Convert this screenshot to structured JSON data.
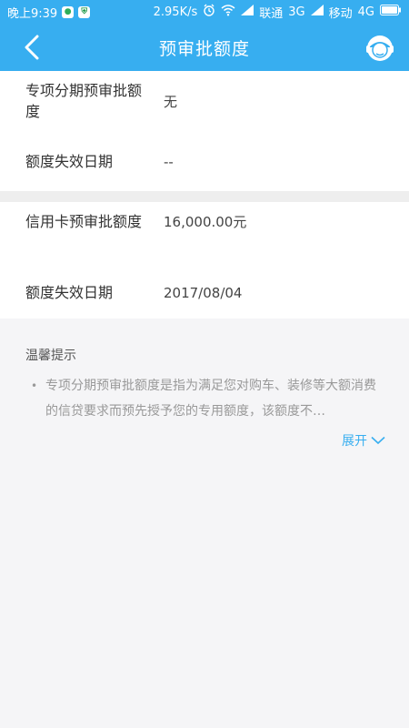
{
  "status_bar": {
    "time": "晚上9:39",
    "speed": "2.95K/s",
    "carrier1": "联通",
    "net1": "3G",
    "carrier2": "移动",
    "net2": "4G"
  },
  "nav": {
    "title": "预审批额度",
    "back_icon": "chevron-left-icon",
    "service_icon": "customer-service-icon"
  },
  "section1": {
    "rows": [
      {
        "label": "专项分期预审批额度",
        "value": "无"
      },
      {
        "label": "额度失效日期",
        "value": "--"
      }
    ]
  },
  "section2": {
    "rows": [
      {
        "label": "信用卡预审批额度",
        "value": "16,000.00元"
      },
      {
        "label": "额度失效日期",
        "value": "2017/08/04"
      }
    ]
  },
  "tips": {
    "title": "温馨提示",
    "items": [
      {
        "text": "专项分期预审批额度是指为满足您对购车、装修等大额消费的信贷要求而预先授予您的专用额度，该额度不…"
      }
    ],
    "expand_label": "展开"
  },
  "colors": {
    "primary": "#37aef0",
    "background": "#f5f5f7"
  }
}
